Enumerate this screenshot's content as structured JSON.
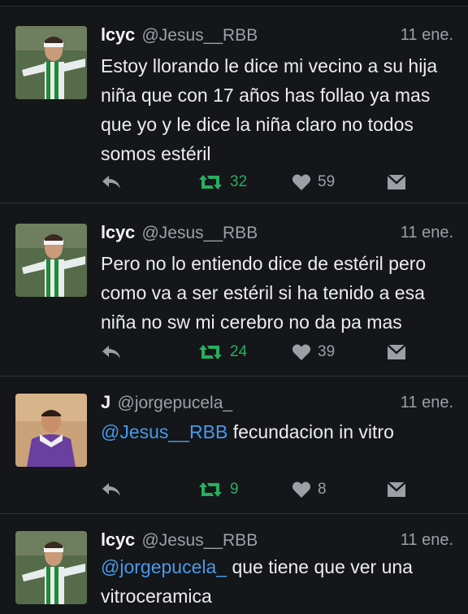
{
  "tweets": [
    {
      "name": "lcyc",
      "handle": "@Jesus__RBB",
      "time": "11 ene.",
      "text": "Estoy llorando le dice mi vecino a su hija niña que con 17 años has follao ya mas que yo y le dice la niña claro no todos somos estéril",
      "retweets": "32",
      "likes": "59",
      "avatar_icon": "footballer-green-kit-icon"
    },
    {
      "name": "lcyc",
      "handle": "@Jesus__RBB",
      "time": "11 ene.",
      "text": "Pero no lo entiendo dice de estéril pero como va a ser estéril si ha tenido a esa niña no sw mi cerebro no da pa mas",
      "retweets": "24",
      "likes": "39",
      "avatar_icon": "footballer-green-kit-icon"
    },
    {
      "name": "J",
      "handle": "@jorgepucela_",
      "time": "11 ene.",
      "mention": "@Jesus__RBB",
      "text": " fecundacion in vitro",
      "retweets": "9",
      "likes": "8",
      "avatar_icon": "footballer-purple-kit-icon"
    },
    {
      "name": "lcyc",
      "handle": "@Jesus__RBB",
      "time": "11 ene.",
      "mention": "@jorgepucela_",
      "text": " que tiene que ver una vitroceramica",
      "avatar_icon": "footballer-green-kit-icon"
    }
  ],
  "colors": {
    "background": "#141619",
    "mention": "#4a99e9",
    "retweet": "#27ae60",
    "muted": "#9aa0a6"
  },
  "icons": [
    "reply-icon",
    "retweet-icon",
    "heart-icon",
    "direct-message-icon"
  ]
}
